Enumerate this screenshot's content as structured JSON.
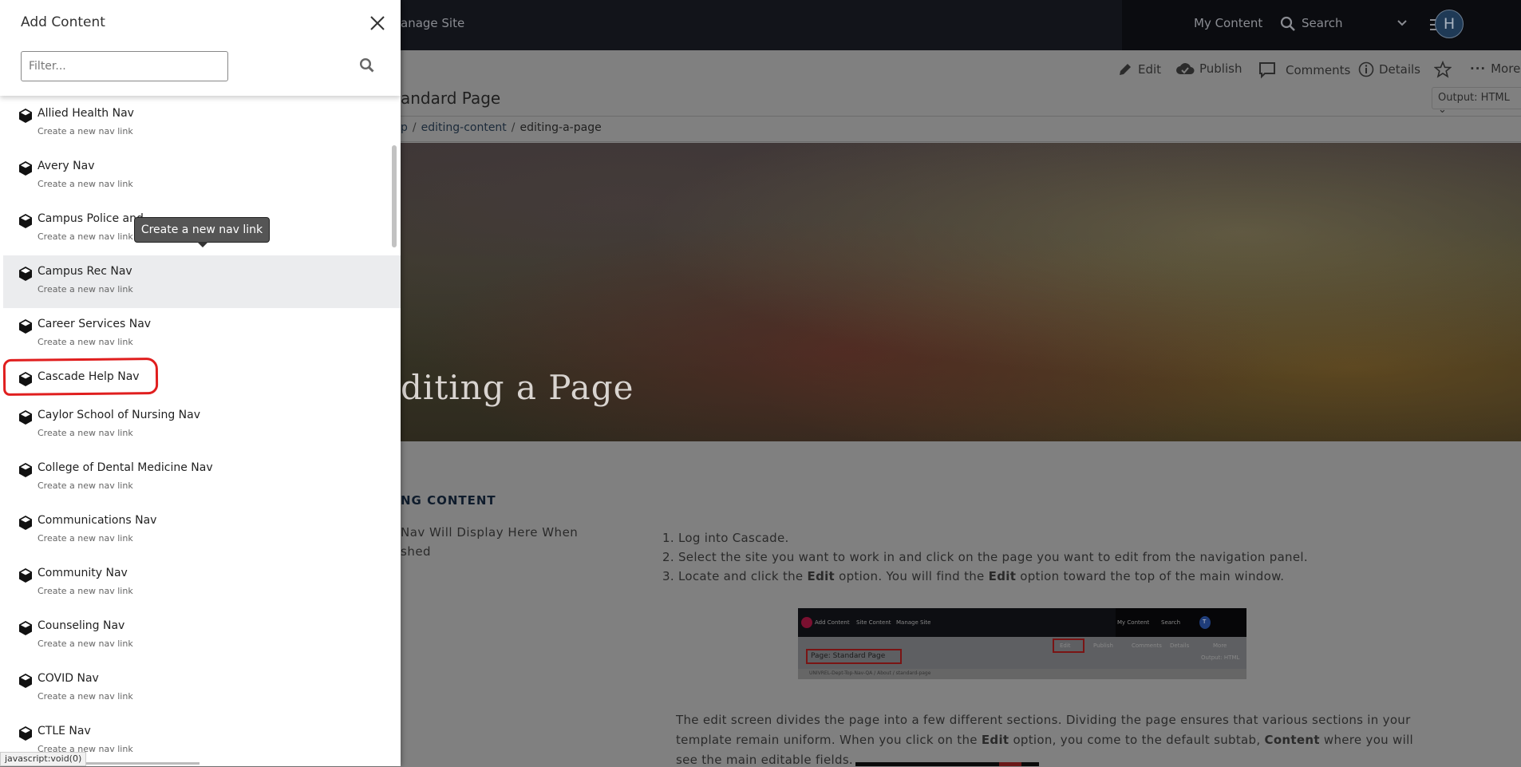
{
  "topbar": {
    "manage_site": "anage Site",
    "my_content": "My Content",
    "search": "Search",
    "avatar_initial": "H"
  },
  "toolbar": {
    "edit": "Edit",
    "publish": "Publish",
    "comments": "Comments",
    "details": "Details",
    "more": "More",
    "output": "Output: HTML"
  },
  "page": {
    "title": "andard Page",
    "breadcrumb": [
      "p",
      "editing-content",
      "editing-a-page"
    ],
    "hero_title": "diting a Page",
    "left_heading": "NG CONTENT",
    "left_text": [
      "Nav Will Display Here When",
      "shed"
    ],
    "steps": [
      [
        "1. Log into Cascade."
      ],
      [
        "2. Select the site you want to work in and click on the page you want to edit from the navigation panel."
      ],
      [
        "3. Locate and click the ",
        "Edit",
        " option. You will find the ",
        "Edit",
        " option toward the top of the main window."
      ]
    ],
    "embedded_screenshot": {
      "add_content": "Add Content",
      "site_content": "Site Content",
      "manage_site": "Manage Site",
      "my_content": "My Content",
      "search": "Search",
      "avatar": "T",
      "edit": "Edit",
      "publish": "Publish",
      "comments": "Comments",
      "details": "Details",
      "more": "More",
      "page_title": "Page: Standard Page",
      "output": "Output: HTML",
      "breadcrumb": "UNIVREL-Dept-Top-Nav-QA / About / standard-page"
    },
    "paragraph": {
      "line1": "The edit screen divides the page into a few different sections. Dividing the page ensures that various sections in your",
      "line2a": "template remain uniform. When you click on the ",
      "line2b": "Edit",
      "line2c": " option, you come to the default subtab, ",
      "line2d": "Content",
      "line2e": " where you will",
      "line3": "see the main editable fields."
    }
  },
  "panel": {
    "title": "Add Content",
    "filter_placeholder": "Filter...",
    "items": [
      {
        "title": "Allied Health Nav",
        "subtitle": "Create a new nav link"
      },
      {
        "title": "Avery Nav",
        "subtitle": "Create a new nav link"
      },
      {
        "title": "Campus Police and",
        "subtitle": "Create a new nav link"
      },
      {
        "title": "Campus Rec Nav",
        "subtitle": "Create a new nav link",
        "hovered": true
      },
      {
        "title": "Career Services Nav",
        "subtitle": "Create a new nav link"
      },
      {
        "title": "Cascade Help Nav",
        "subtitle": "",
        "annotated": true
      },
      {
        "title": "Caylor School of Nursing Nav",
        "subtitle": "Create a new nav link"
      },
      {
        "title": "College of Dental Medicine Nav",
        "subtitle": "Create a new nav link"
      },
      {
        "title": "Communications Nav",
        "subtitle": "Create a new nav link"
      },
      {
        "title": "Community Nav",
        "subtitle": "Create a new nav link"
      },
      {
        "title": "Counseling Nav",
        "subtitle": "Create a new nav link"
      },
      {
        "title": "COVID Nav",
        "subtitle": "Create a new nav link"
      },
      {
        "title": "CTLE Nav",
        "subtitle": "Create a new nav link"
      }
    ],
    "tooltip": "Create a new nav link",
    "item_icon": "cube-icon",
    "annotation_color": "#e01e1e"
  },
  "status_bar": "javascript:void(0)"
}
